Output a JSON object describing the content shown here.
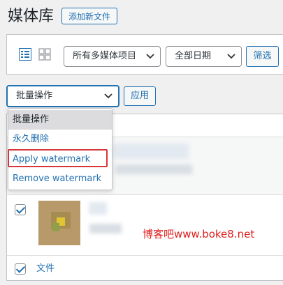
{
  "header": {
    "title": "媒体库",
    "add_new_label": "添加新文件"
  },
  "filters": {
    "type_select": "所有多媒体项目",
    "date_select": "全部日期",
    "filter_button": "筛选"
  },
  "bulk": {
    "select_label": "批量操作",
    "apply_button": "应用",
    "options": [
      "批量操作",
      "永久删除",
      "Apply watermark",
      "Remove watermark"
    ],
    "highlighted_option": "Apply watermark"
  },
  "table": {
    "footer_column_label": "文件"
  },
  "overlay": {
    "watermark_text": "博客吧www.boke8.net"
  },
  "colors": {
    "accent": "#2271b1",
    "highlight": "#d63638",
    "watermark": "#e02020"
  },
  "icons": [
    "list-view-icon",
    "grid-view-icon",
    "chevron-down-icon",
    "checkmark-icon"
  ]
}
